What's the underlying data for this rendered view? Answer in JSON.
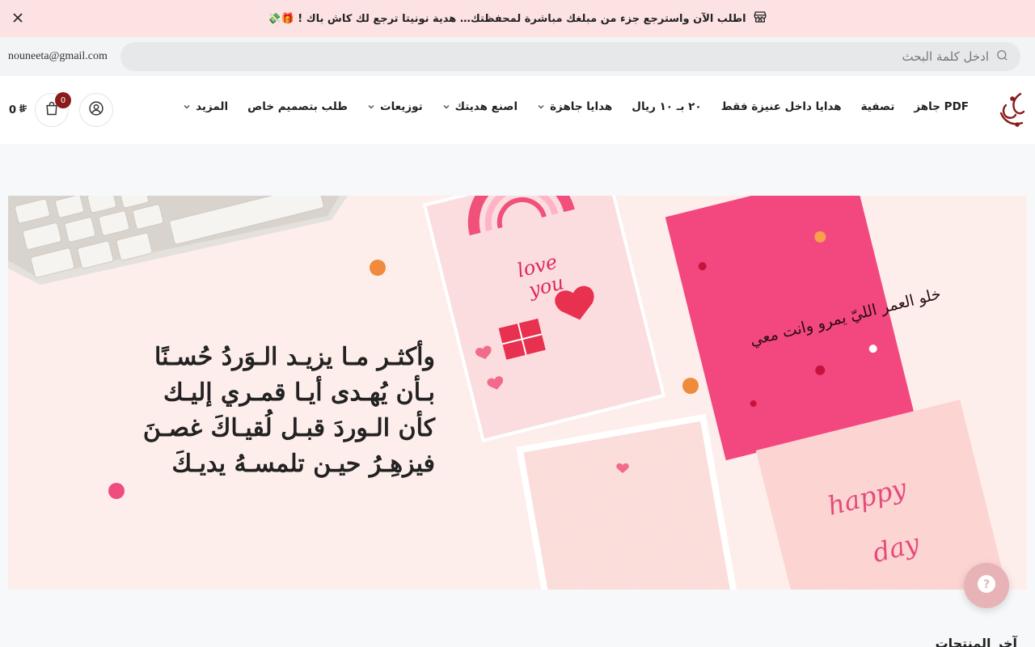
{
  "announcement": {
    "text": "اطلب الآن واسترجع جزء من مبلغك مباشرة لمحفظتك… هدية نونيتا ترجع لك كاش باك ! 🎁💸",
    "icon": "store-icon",
    "close_icon": "close-icon"
  },
  "topbar": {
    "email": "nouneeta@gmail.com",
    "search_placeholder": "ادخل كلمة البحث",
    "search_icon": "search-icon"
  },
  "nav": {
    "items": [
      {
        "label": "PDF جاهز",
        "has_dropdown": false
      },
      {
        "label": "تصفية",
        "has_dropdown": false
      },
      {
        "label": "هدايا داخل عنيزة فقط",
        "has_dropdown": false
      },
      {
        "label": "٢٠ بـ ١٠ ريال",
        "has_dropdown": false
      },
      {
        "label": "هدايا جاهزة",
        "has_dropdown": true
      },
      {
        "label": "اصنع هديتك",
        "has_dropdown": true
      },
      {
        "label": "توزيعات",
        "has_dropdown": true
      },
      {
        "label": "طلب بتصميم خاص",
        "has_dropdown": false
      },
      {
        "label": "المزيد",
        "has_dropdown": true
      }
    ]
  },
  "cart": {
    "count": "0",
    "total": "0",
    "currency_icon": "riyal-icon"
  },
  "banner": {
    "poem_lines": [
      "وأكثـر مـا يزيـد الـوَردُ حُسـنًا",
      "بـأن يُهـدى أيـا قمـري إليـك",
      "كأن الـوردَ قبـل لُقيـاكَ غصـنَ",
      "فيزهِـرُ حيـن تلمسـهُ يديـكَ"
    ],
    "card_text_1": "love you",
    "card_text_2": "happy",
    "card_text_3": "day",
    "card_calligraphy": "خلو العمر الليّ يمرو وانت معي"
  },
  "section": {
    "title": "آخر المنتجات"
  },
  "colors": {
    "announce_bg": "#fde2e3",
    "brand": "#8b1a1a",
    "banner_bg": "#fdebe8",
    "pink_card": "#f3487f",
    "help_btn": "#e7b3b6"
  }
}
